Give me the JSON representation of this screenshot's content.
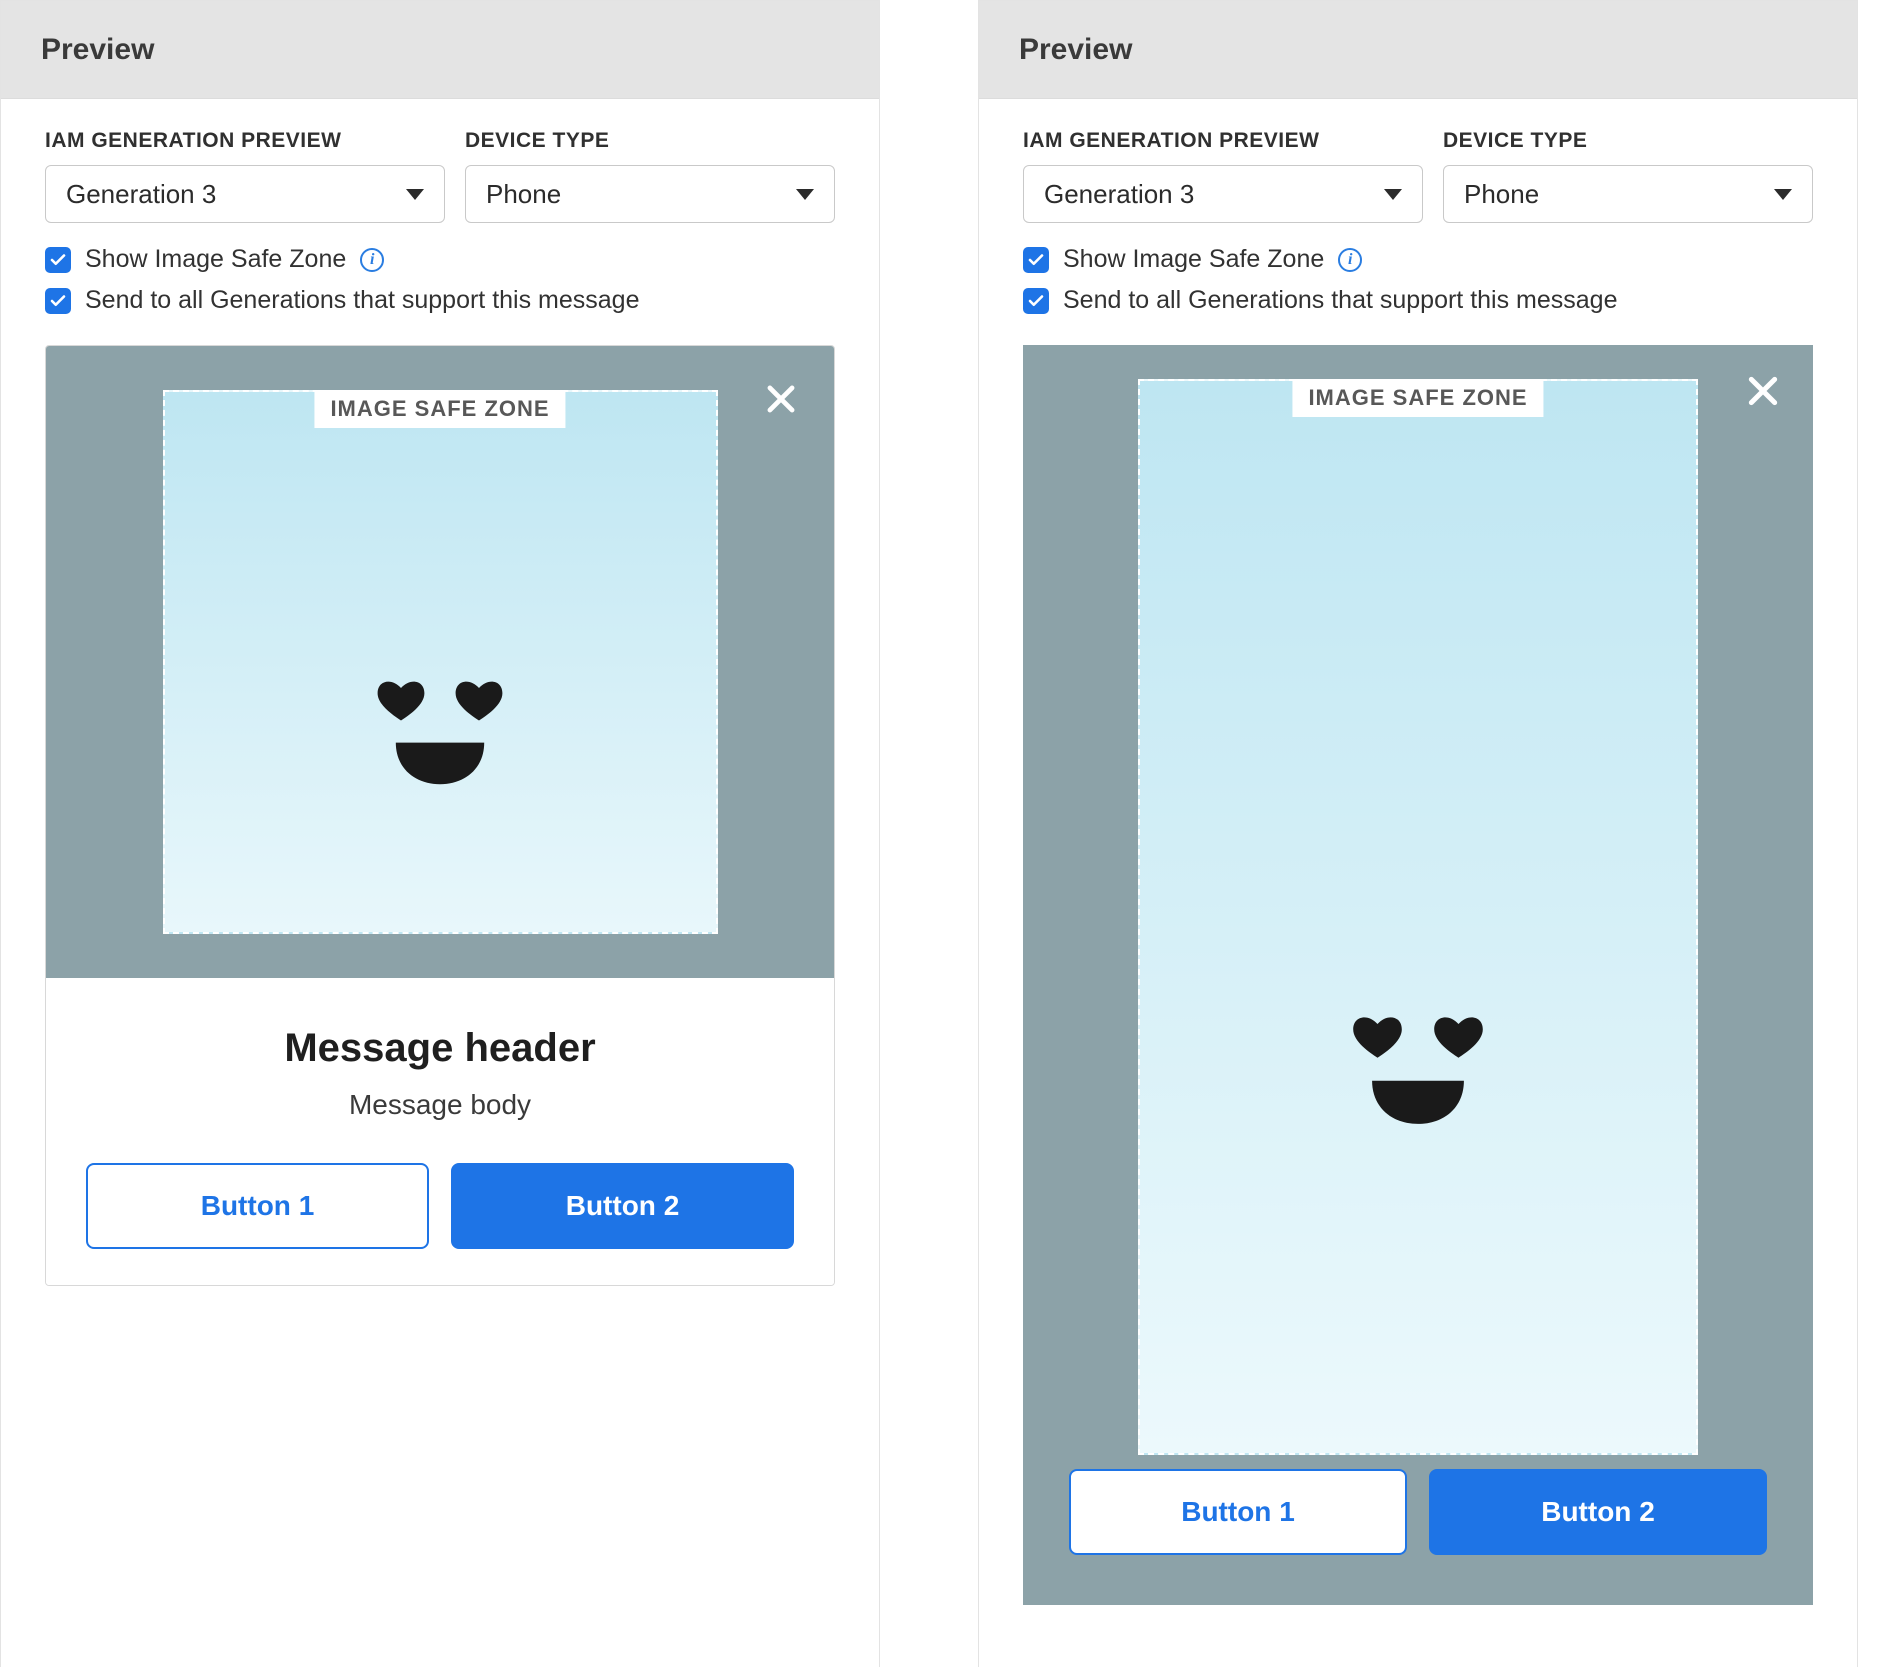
{
  "left": {
    "title": "Preview",
    "gen_label": "IAM GENERATION PREVIEW",
    "gen_value": "Generation 3",
    "device_label": "DEVICE TYPE",
    "device_value": "Phone",
    "check1": "Show Image Safe Zone",
    "check2": "Send to all Generations that support this message",
    "safe_zone": "IMAGE SAFE ZONE",
    "msg_header": "Message header",
    "msg_body": "Message body",
    "btn1": "Button 1",
    "btn2": "Button 2"
  },
  "right": {
    "title": "Preview",
    "gen_label": "IAM GENERATION PREVIEW",
    "gen_value": "Generation 3",
    "device_label": "DEVICE TYPE",
    "device_value": "Phone",
    "check1": "Show Image Safe Zone",
    "check2": "Send to all Generations that support this message",
    "safe_zone": "IMAGE SAFE ZONE",
    "btn1": "Button 1",
    "btn2": "Button 2"
  }
}
